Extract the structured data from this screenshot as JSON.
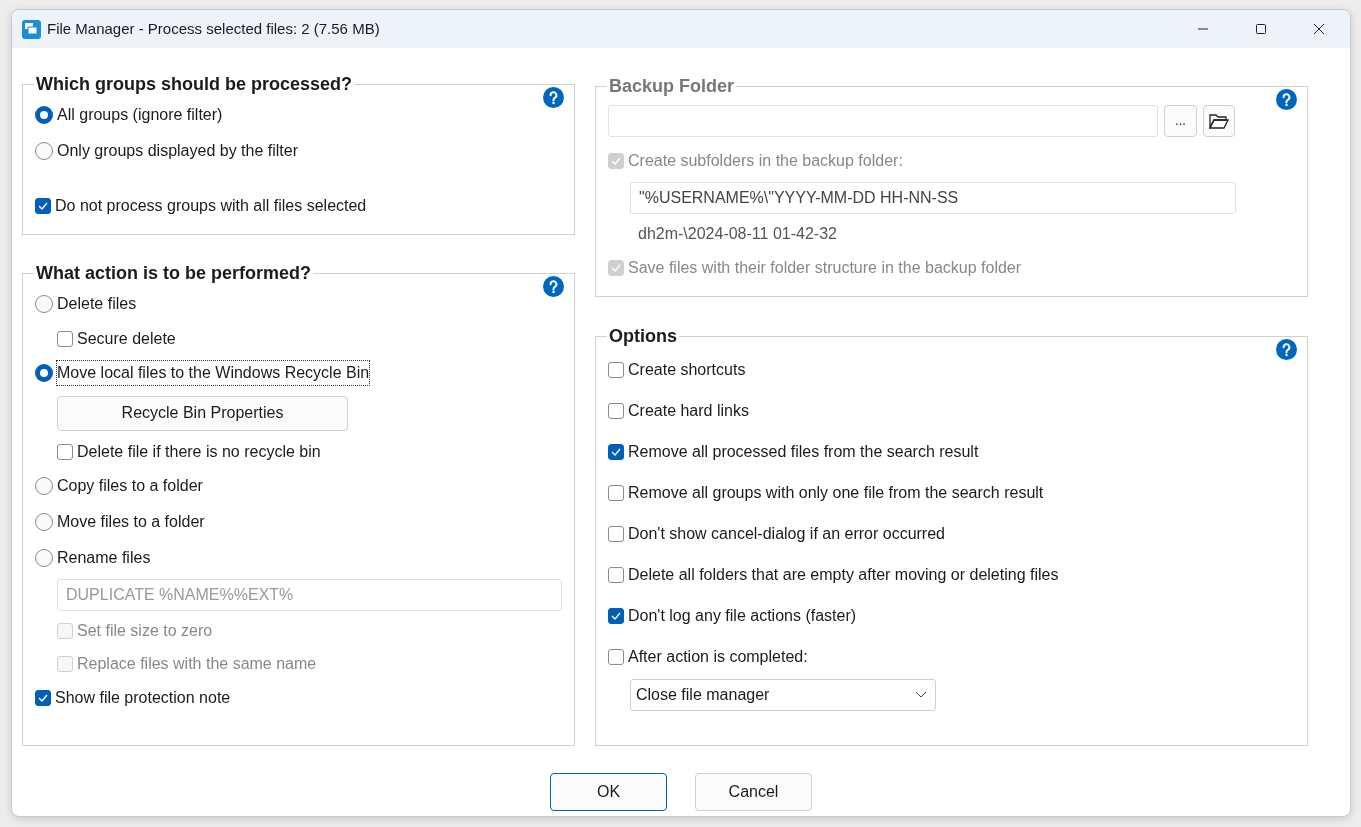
{
  "window": {
    "title": "File Manager - Process selected files: 2 (7.56 MB)"
  },
  "left_groups": [
    {
      "title": "Which groups should be processed?",
      "disabled": false,
      "items": [
        {
          "kind": "radio",
          "label": "All groups (ignore filter)",
          "selected": true,
          "focused": false
        },
        {
          "kind": "radio",
          "label": "Only groups displayed by the filter",
          "selected": false,
          "focused": false
        },
        {
          "kind": "checkbox",
          "label": "Do not process groups with all files selected",
          "checked": true,
          "disabled": false
        }
      ]
    },
    {
      "title": "What action is to be performed?",
      "disabled": false,
      "items": [
        {
          "kind": "radio",
          "label": "Delete files",
          "selected": false,
          "focused": false,
          "children": [
            {
              "kind": "checkbox",
              "label": "Secure delete",
              "checked": false,
              "disabled": false
            }
          ]
        },
        {
          "kind": "radio",
          "label": "Move local files to the Windows Recycle Bin",
          "selected": true,
          "focused": true,
          "children": [
            {
              "kind": "button",
              "label": "Recycle Bin Properties"
            },
            {
              "kind": "checkbox",
              "label": "Delete file if there is no recycle bin",
              "checked": false,
              "disabled": false
            }
          ]
        },
        {
          "kind": "radio",
          "label": "Copy files to a folder",
          "selected": false,
          "focused": false
        },
        {
          "kind": "radio",
          "label": "Move files to a folder",
          "selected": false,
          "focused": false
        },
        {
          "kind": "radio",
          "label": "Rename files",
          "selected": false,
          "focused": false,
          "children": [
            {
              "kind": "field",
              "value": "DUPLICATE %NAME%%EXT%",
              "disabled": true
            },
            {
              "kind": "checkbox",
              "label": "Set file size to zero",
              "checked": false,
              "disabled": true
            },
            {
              "kind": "checkbox",
              "label": "Replace files with the same name",
              "checked": false,
              "disabled": true
            }
          ]
        },
        {
          "kind": "checkbox",
          "label": "Show file protection note",
          "checked": true,
          "disabled": false
        }
      ]
    }
  ],
  "right_groups": [
    {
      "title": "Backup Folder",
      "disabled": true,
      "items": [
        {
          "kind": "path",
          "value": "",
          "browse_label": "..."
        },
        {
          "kind": "checkbox",
          "label": "Create subfolders in the backup folder:",
          "checked": true,
          "disabled": true,
          "children": [
            {
              "kind": "field",
              "value": "\"%USERNAME%\\\"YYYY-MM-DD HH-NN-SS",
              "disabled": false
            },
            {
              "kind": "note",
              "text": "dh2m-\\2024-08-11 01-42-32"
            }
          ]
        },
        {
          "kind": "checkbox",
          "label": "Save files with their folder structure in the backup folder",
          "checked": true,
          "disabled": true
        }
      ]
    },
    {
      "title": "Options",
      "disabled": false,
      "items": [
        {
          "kind": "checkbox",
          "label": "Create shortcuts",
          "checked": false,
          "disabled": false
        },
        {
          "kind": "checkbox",
          "label": "Create hard links",
          "checked": false,
          "disabled": false
        },
        {
          "kind": "checkbox",
          "label": "Remove all processed files from the search result",
          "checked": true,
          "disabled": false
        },
        {
          "kind": "checkbox",
          "label": "Remove all groups with only one file from the search result",
          "checked": false,
          "disabled": false
        },
        {
          "kind": "checkbox",
          "label": "Don't show cancel-dialog if an error occurred",
          "checked": false,
          "disabled": false
        },
        {
          "kind": "checkbox",
          "label": "Delete all folders that are empty after moving or deleting files",
          "checked": false,
          "disabled": false
        },
        {
          "kind": "checkbox",
          "label": "Don't log any file actions (faster)",
          "checked": true,
          "disabled": false
        },
        {
          "kind": "checkbox",
          "label": "After action is completed:",
          "checked": false,
          "disabled": false,
          "children": [
            {
              "kind": "select",
              "value": "Close file manager"
            }
          ]
        }
      ]
    }
  ],
  "buttons": [
    {
      "label": "OK",
      "default": true
    },
    {
      "label": "Cancel",
      "default": false
    }
  ]
}
